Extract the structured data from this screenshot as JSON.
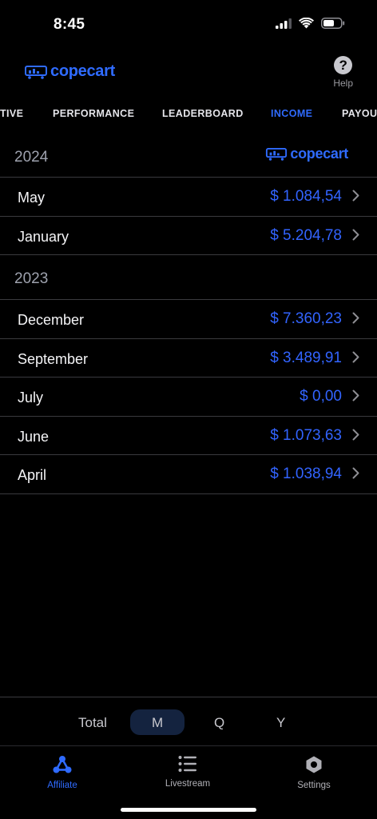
{
  "status": {
    "time": "8:45"
  },
  "header": {
    "logo_text": "copecart",
    "help_label": "Help",
    "help_glyph": "?"
  },
  "tabs": [
    {
      "label": "TIVE"
    },
    {
      "label": "PERFORMANCE"
    },
    {
      "label": "LEADERBOARD"
    },
    {
      "label": "INCOME",
      "active": true
    },
    {
      "label": "PAYOUT"
    }
  ],
  "sections": [
    {
      "year": "2024",
      "logo_text": "copecart",
      "rows": [
        {
          "label": "May",
          "value": "$ 1.084,54"
        },
        {
          "label": "January",
          "value": "$ 5.204,78"
        }
      ]
    },
    {
      "year": "2023",
      "rows": [
        {
          "label": "December",
          "value": "$ 7.360,23"
        },
        {
          "label": "September",
          "value": "$ 3.489,91"
        },
        {
          "label": "July",
          "value": "$ 0,00"
        },
        {
          "label": "June",
          "value": "$ 1.073,63"
        },
        {
          "label": "April",
          "value": "$ 1.038,94"
        }
      ]
    }
  ],
  "period_selector": {
    "total": "Total",
    "options": [
      "M",
      "Q",
      "Y"
    ],
    "selected": "M"
  },
  "bottom_nav": [
    {
      "label": "Affiliate",
      "icon": "affiliate-icon",
      "active": true
    },
    {
      "label": "Livestream",
      "icon": "list-icon"
    },
    {
      "label": "Settings",
      "icon": "hexagon-icon"
    }
  ],
  "colors": {
    "accent": "#2f6bff",
    "value": "#3264ff",
    "background": "#000000",
    "divider": "#3a3a3e"
  }
}
